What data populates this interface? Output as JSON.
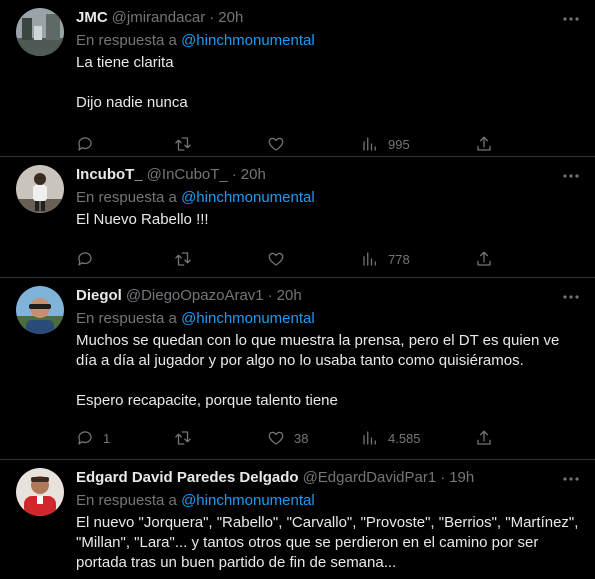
{
  "colors": {
    "background": "#000000",
    "text": "#e7e9ea",
    "muted": "#71767b",
    "accent": "#1d9bf0",
    "divider": "#2f3336"
  },
  "tweets": [
    {
      "name": "JMC",
      "handle": "@jmirandacar",
      "dot": "·",
      "time": "20h",
      "reply_prefix": "En respuesta a ",
      "reply_to": "@hinchmonumental",
      "text": "La tiene clarita\n\nDijo nadie nunca",
      "replies": "",
      "retweets": "",
      "likes": "",
      "views": "995",
      "icons": [
        "reply-icon",
        "retweet-icon",
        "heart-icon",
        "views-icon",
        "share-icon",
        "more-icon"
      ]
    },
    {
      "name": "IncuboT_",
      "handle": "@InCuboT_",
      "dot": "·",
      "time": "20h",
      "reply_prefix": "En respuesta a ",
      "reply_to": "@hinchmonumental",
      "text": "El Nuevo Rabello !!!",
      "replies": "",
      "retweets": "",
      "likes": "",
      "views": "778",
      "icons": [
        "reply-icon",
        "retweet-icon",
        "heart-icon",
        "views-icon",
        "share-icon",
        "more-icon"
      ]
    },
    {
      "name": "Diegol",
      "handle": "@DiegoOpazoArav1",
      "dot": "·",
      "time": "20h",
      "reply_prefix": "En respuesta a ",
      "reply_to": "@hinchmonumental",
      "text": "Muchos se quedan con lo que muestra la prensa, pero el DT es quien ve día a día al jugador y por algo no lo usaba tanto como quisiéramos.\n\nEspero recapacite, porque talento tiene",
      "replies": "1",
      "retweets": "",
      "likes": "38",
      "views": "4.585",
      "icons": [
        "reply-icon",
        "retweet-icon",
        "heart-icon",
        "views-icon",
        "share-icon",
        "more-icon"
      ]
    },
    {
      "name": "Edgard David Paredes Delgado",
      "handle": "@EdgardDavidPar1",
      "dot": "·",
      "time": "19h",
      "reply_prefix": "En respuesta a ",
      "reply_to": "@hinchmonumental",
      "text": "El nuevo \"Jorquera\", \"Rabello\", \"Carvallo\", \"Provoste\", \"Berrios\", \"Martínez\", \"Millan\", \"Lara\"... y tantos otros que se perdieron en el camino por ser portada tras un buen partido de fin de semana...",
      "icons": [
        "more-icon"
      ]
    }
  ]
}
